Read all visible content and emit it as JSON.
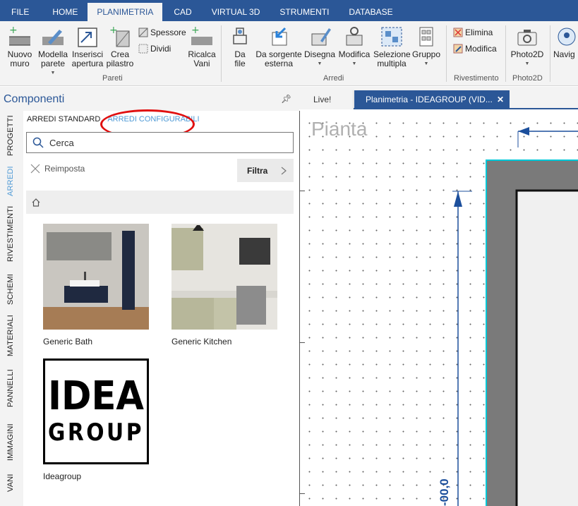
{
  "menu": {
    "tabs": [
      "FILE",
      "HOME",
      "PLANIMETRIA",
      "CAD",
      "VIRTUAL 3D",
      "STRUMENTI",
      "DATABASE"
    ],
    "active": "PLANIMETRIA"
  },
  "ribbon": {
    "pareti": {
      "nuovo_muro": "Nuovo muro",
      "modella_parete": "Modella parete",
      "inserisci_apertura": "Inserisci apertura",
      "crea_pilastro": "Crea pilastro",
      "spessore": "Spessore",
      "dividi": "Dividi",
      "ricalca_vani": "Ricalca Vani",
      "group_label": "Pareti"
    },
    "arredi": {
      "da_file": "Da file",
      "da_sorgente_esterna": "Da sorgente esterna",
      "disegna": "Disegna",
      "modifica": "Modifica",
      "selezione_multipla": "Selezione multipla",
      "gruppo": "Gruppo",
      "group_label": "Arredi"
    },
    "rivestimento": {
      "elimina": "Elimina",
      "modifica": "Modifica",
      "group_label": "Rivestimento"
    },
    "photo2d": {
      "photo2d": "Photo2D",
      "group_label": "Photo2D"
    },
    "navig": "Navig"
  },
  "panel": {
    "title": "Componenti",
    "vertical_tabs": [
      "PROGETTI",
      "ARREDI",
      "RIVESTIMENTI",
      "SCHEMI",
      "MATERIALI",
      "PANNELLI",
      "IMMAGINI",
      "VANI"
    ],
    "active_vertical_tab": "ARREDI",
    "subtabs": {
      "standard": "ARREDI STANDARD",
      "configurabili": "ARREDI CONFIGURABILI"
    },
    "search_placeholder": "Cerca",
    "reset_label": "Reimposta",
    "filter_label": "Filtra",
    "items": [
      {
        "name": "Generic Bath"
      },
      {
        "name": "Generic Kitchen"
      },
      {
        "name": "Ideagroup"
      }
    ],
    "logo_text": {
      "line1": "IDEA",
      "line2": "GROUP"
    }
  },
  "documents": {
    "tabs": [
      "Live!",
      "Planimetria - IDEAGROUP (VID..."
    ],
    "active": "Planimetria - IDEAGROUP (VID..."
  },
  "canvas": {
    "view_label": "Pianta",
    "dimension_text": "-00,0"
  },
  "colors": {
    "brand": "#2b5797",
    "accent": "#4f9ad6",
    "highlight_circle": "#e01010",
    "wall": "#7a7a7a",
    "wall_outline": "#00c8d8"
  }
}
